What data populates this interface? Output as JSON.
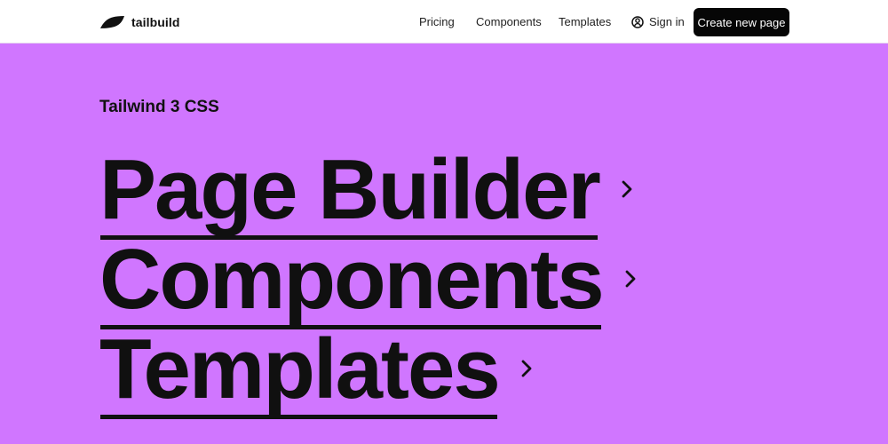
{
  "header": {
    "brand_name": "tailbuild",
    "nav_items": [
      {
        "label": "Pricing"
      },
      {
        "label": "Components"
      },
      {
        "label": "Templates"
      }
    ],
    "sign_in_label": "Sign in",
    "create_button_label": "Create new page"
  },
  "hero": {
    "eyebrow": "Tailwind 3 CSS",
    "links": [
      {
        "label": "Page Builder",
        "icon": "chevron-right-icon"
      },
      {
        "label": "Components",
        "icon": "chevron-right-icon"
      },
      {
        "label": "Templates",
        "icon": "chevron-right-icon"
      }
    ]
  },
  "colors": {
    "page_background": "#d076ff",
    "header_background": "#ffffff",
    "primary_text": "#111111",
    "cta_background": "#060606",
    "cta_text": "#ffffff"
  }
}
